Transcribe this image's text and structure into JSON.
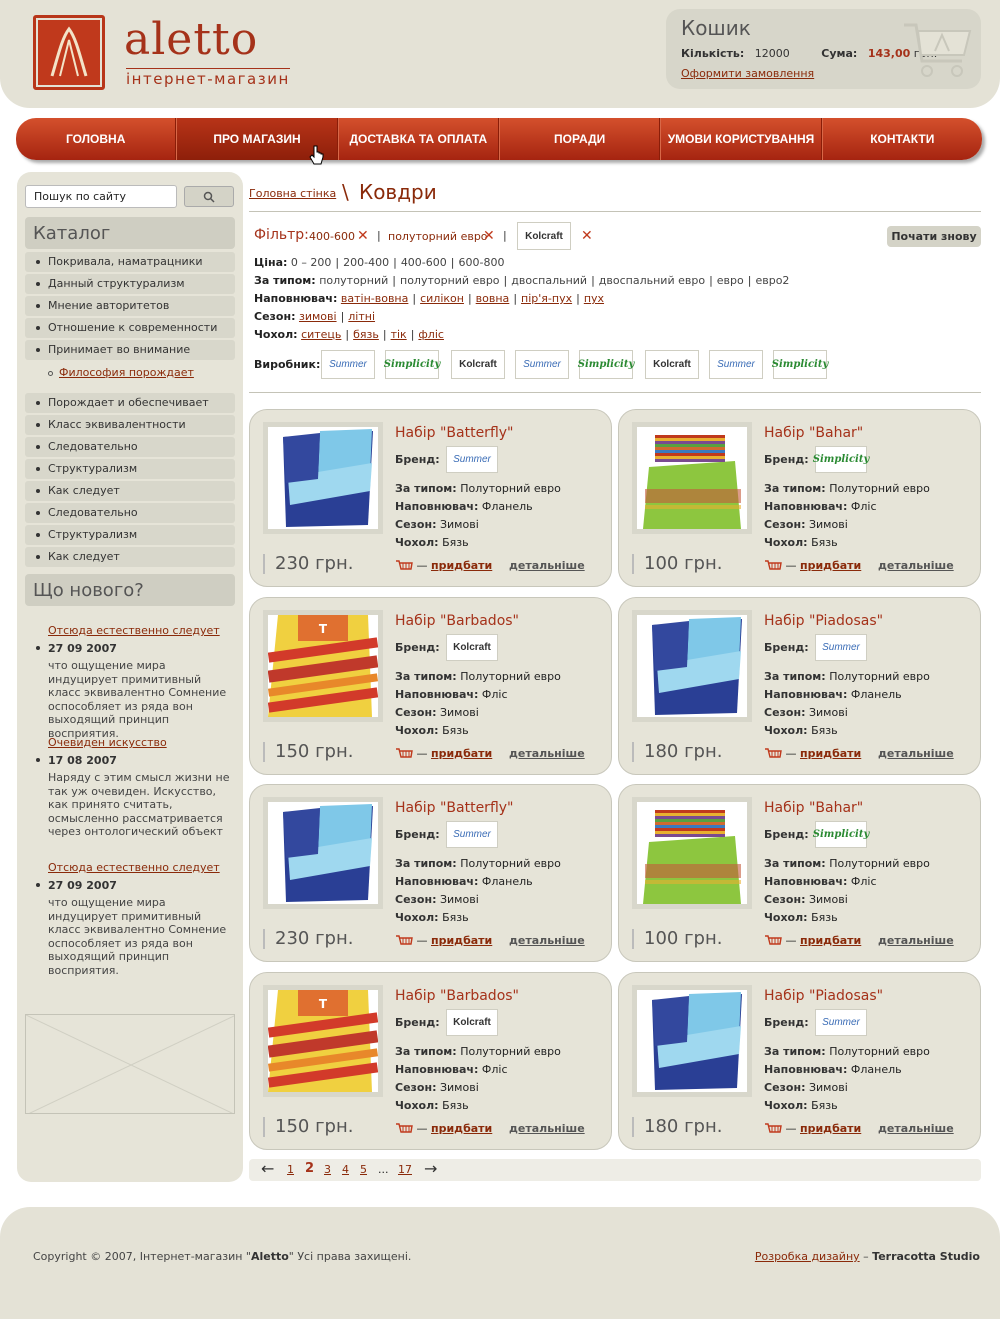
{
  "header": {
    "logo_name": "aletto",
    "logo_sub": "інтернет-магазин",
    "cart": {
      "title": "Кошик",
      "qty_label": "Кількість:",
      "qty_value": "12000",
      "sum_label": "Сума:",
      "sum_value": "143,00",
      "sum_currency": "грн.",
      "order_link": "Оформити замовлення"
    }
  },
  "nav": [
    {
      "label": "Головна"
    },
    {
      "label": "Про магазин"
    },
    {
      "label": "Доставка та оплата"
    },
    {
      "label": "Поради"
    },
    {
      "label": "Умови користування"
    },
    {
      "label": "Контакти"
    }
  ],
  "sidebar": {
    "search_placeholder": "Пошук по сайту",
    "catalog_title": "Каталог",
    "catalog": [
      "Покривала, наматрацники",
      "Данный структурализм",
      "Мнение авторитетов",
      "Отношение к современности",
      "Принимает во внимание",
      "Порождает и обеспечивает",
      "Класс эквивалентности",
      "Следовательно",
      "Структурализм",
      "Как следует",
      "Следовательно",
      "Структурализм",
      "Как следует"
    ],
    "catalog_sub": "Философия порождает",
    "news_title": "Що нового?",
    "news": [
      {
        "link": "Отсюда естественно следует",
        "date": "27 09 2007",
        "text": "что ощущение мира индуцирует примитивный класс эквивалентно Сомнение оспособляет из ряда вон выходящий принцип восприятия."
      },
      {
        "link": "Очевиден искусство",
        "date": "17 08 2007",
        "text": "Наряду с этим смысл жизни не так уж очевиден. Искусство, как принято считать, осмысленно рассматривается через онтологический объект"
      },
      {
        "link": "Отсюда естественно следует",
        "date": "27 09 2007",
        "text": "что ощущение мира индуцирует примитивный класс эквивалентно Сомнение оспособляет из ряда вон выходящий принцип восприятия."
      }
    ]
  },
  "breadcrumb": {
    "home": "Головна стінка",
    "sep": "\\",
    "title": "Ковдри"
  },
  "filter": {
    "label": "Фільтр:",
    "chip1": "400-600",
    "chip2": "полуторний евро",
    "chip3_logo": "Kolcraft",
    "pipe": "|",
    "reset": "Почати знову"
  },
  "filter_rows": {
    "price": {
      "label": "Ціна:",
      "options": [
        "0 – 200",
        "200-400",
        "400-600",
        "600-800"
      ]
    },
    "type": {
      "label": "За типом:",
      "options": [
        "полуторний",
        "полуторний евро",
        "двоспальний",
        "двоспальний евро",
        "евро",
        "евро2"
      ]
    },
    "filler": {
      "label": "Наповнювач:",
      "options": [
        "ватін-вовна",
        "силікон",
        "вовна",
        "пір'я-пух",
        "пух"
      ]
    },
    "season": {
      "label": "Сезон:",
      "options": [
        "зимові",
        "літні"
      ]
    },
    "cover": {
      "label": "Чохол:",
      "options": [
        "ситець",
        "бязь",
        "тік",
        "фліс"
      ]
    },
    "maker": {
      "label": "Виробник:",
      "logos": [
        "Summer",
        "Simplicity",
        "Kolcraft",
        "Summer",
        "Simplicity",
        "Kolcraft",
        "Summer",
        "Simplicity"
      ]
    }
  },
  "labels": {
    "brand": "Бренд:",
    "type": "За типом:",
    "filler": "Наповнювач:",
    "season": "Сезон:",
    "cover": "Чохол:",
    "buy": "придбати",
    "dash": "—",
    "more": "детальніше"
  },
  "products": [
    {
      "title": "Набір \"Batterfly\"",
      "brand": "Summer",
      "type": "Полуторний евро",
      "filler": "Фланель",
      "season": "Зимові",
      "cover": "Бязь",
      "price": "230 грн.",
      "img": "blue"
    },
    {
      "title": "Набір \"Bahar\"",
      "brand": "Simplicity",
      "type": "Полуторний евро",
      "filler": "Фліс",
      "season": "Зимові",
      "cover": "Бязь",
      "price": "100 грн.",
      "img": "green"
    },
    {
      "title": "Набір \"Barbados\"",
      "brand": "Kolcraft",
      "type": "Полуторний евро",
      "filler": "Фліс",
      "season": "Зимові",
      "cover": "Бязь",
      "price": "150 грн.",
      "img": "stripes"
    },
    {
      "title": "Набір \"Piadosas\"",
      "brand": "Summer",
      "type": "Полуторний евро",
      "filler": "Фланель",
      "season": "Зимові",
      "cover": "Бязь",
      "price": "180 грн.",
      "img": "blue"
    },
    {
      "title": "Набір \"Batterfly\"",
      "brand": "Summer",
      "type": "Полуторний евро",
      "filler": "Фланель",
      "season": "Зимові",
      "cover": "Бязь",
      "price": "230 грн.",
      "img": "blue"
    },
    {
      "title": "Набір \"Bahar\"",
      "brand": "Simplicity",
      "type": "Полуторний евро",
      "filler": "Фліс",
      "season": "Зимові",
      "cover": "Бязь",
      "price": "100 грн.",
      "img": "green"
    },
    {
      "title": "Набір \"Barbados\"",
      "brand": "Kolcraft",
      "type": "Полуторний евро",
      "filler": "Фліс",
      "season": "Зимові",
      "cover": "Бязь",
      "price": "150 грн.",
      "img": "stripes"
    },
    {
      "title": "Набір \"Piadosas\"",
      "brand": "Summer",
      "type": "Полуторний евро",
      "filler": "Фланель",
      "season": "Зимові",
      "cover": "Бязь",
      "price": "180 грн.",
      "img": "blue"
    }
  ],
  "pager": {
    "prev": "←",
    "pages": [
      "1",
      "2",
      "3",
      "4",
      "5"
    ],
    "current": "2",
    "ellipsis": "...",
    "last": "17",
    "next": "→"
  },
  "footer": {
    "copyright_pre": "Copyright © 2007, Інтернет-магазин \"",
    "copyright_brand": "Aletto",
    "copyright_post": "\"  Усі права захищені.",
    "credit_link": "Розробка дизайну",
    "credit_sep": " – ",
    "credit_studio": "Terracotta Studio"
  },
  "colors": {
    "accent": "#a5321a",
    "nav": "#c0391c",
    "panel": "#e6e4d8"
  }
}
